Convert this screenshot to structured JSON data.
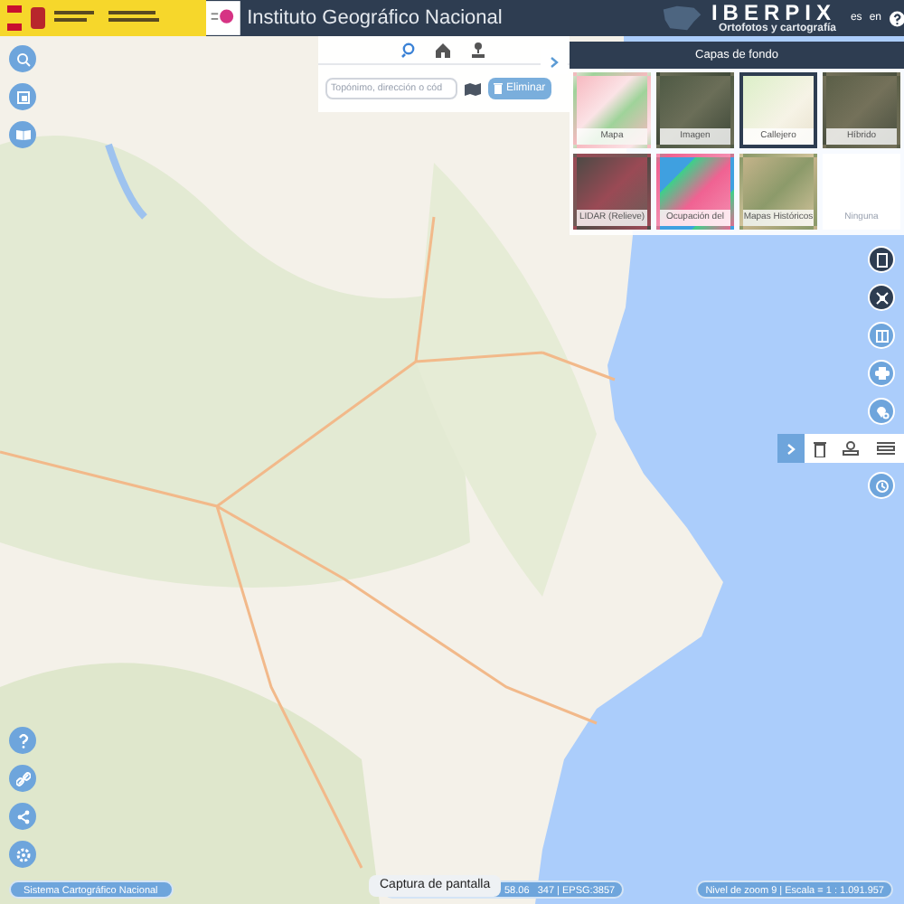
{
  "header": {
    "title": "Instituto Geográfico Nacional",
    "brand": "IBERPIX",
    "brand_subtitle": "Ortofotos y cartografía",
    "languages": [
      "es",
      "en"
    ]
  },
  "search": {
    "tabs": [
      {
        "kind": "search",
        "selected": true
      },
      {
        "kind": "places",
        "selected": false
      },
      {
        "kind": "coordinates",
        "selected": false
      }
    ],
    "placeholder": "Topónimo, dirección o cód",
    "delete_button": "Eliminar"
  },
  "layers": {
    "title": "Capas de fondo",
    "items": [
      {
        "label": "Mapa",
        "kind": "map",
        "selected": false
      },
      {
        "label": "Imagen",
        "kind": "imagery",
        "selected": false
      },
      {
        "label": "Callejero",
        "kind": "street",
        "selected": true
      },
      {
        "label": "Híbrido",
        "kind": "hybrid",
        "selected": false
      },
      {
        "label": "LIDAR (Relieve)",
        "kind": "lidar",
        "selected": false
      },
      {
        "label": "Ocupación del",
        "kind": "landcover",
        "selected": false
      },
      {
        "label": "Mapas Históricos",
        "kind": "historical",
        "selected": false
      },
      {
        "label": "Ninguna",
        "kind": "none",
        "selected": false
      }
    ]
  },
  "status_bar": {
    "system": "Sistema Cartográfico Nacional",
    "tooltip": "Captura de pantalla",
    "coordinates": "58.06   347 | EPSG:3857",
    "scale": "Nivel de zoom 9 | Escala = 1 : 1.091.957"
  }
}
